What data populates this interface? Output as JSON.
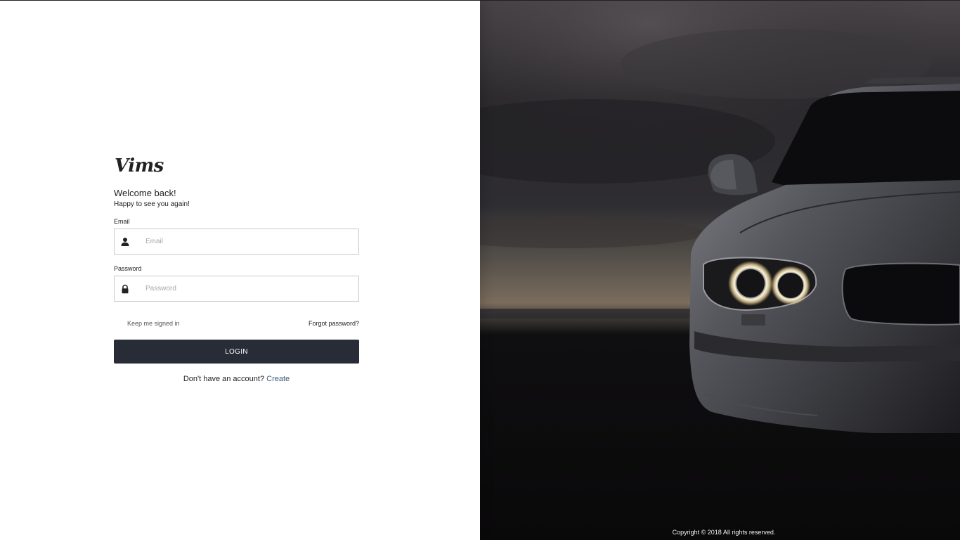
{
  "brand": {
    "logo_text": "Vims"
  },
  "login": {
    "welcome": "Welcome back!",
    "subtitle": "Happy to see you again!",
    "email_label": "Email",
    "email_placeholder": "Email",
    "password_label": "Password",
    "password_placeholder": "Password",
    "keep_signed_in": "Keep me signed in",
    "forgot_password": "Forgot password?",
    "login_button": "LOGIN",
    "signup_prompt": "Don't have an account?",
    "signup_link": "Create"
  },
  "footer": {
    "copyright": "Copyright © 2018 All rights reserved."
  },
  "colors": {
    "button_bg": "#282c37",
    "link": "#3b5a7a"
  },
  "icons": {
    "email": "user-icon",
    "password": "lock-icon"
  }
}
